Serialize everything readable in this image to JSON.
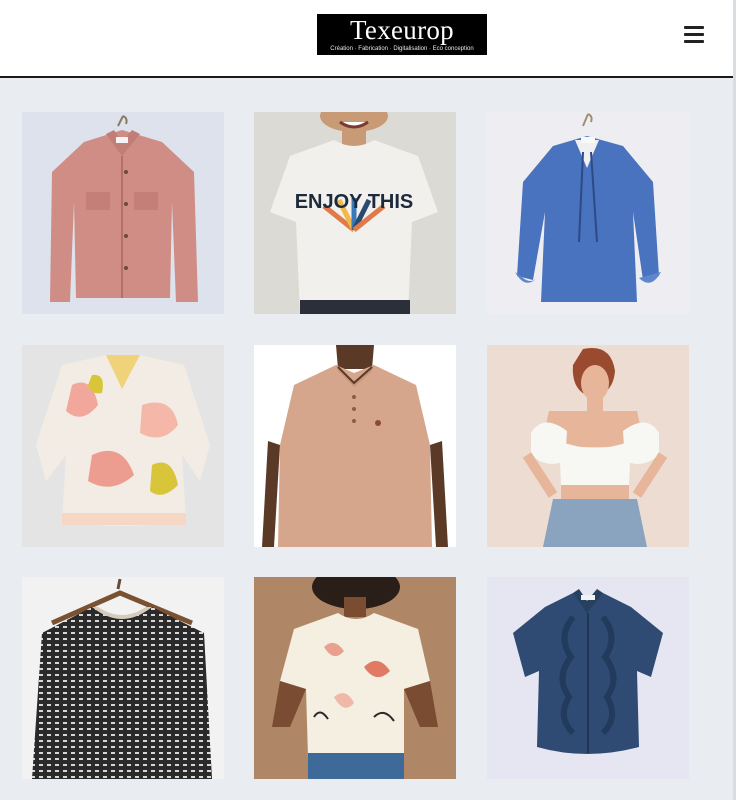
{
  "header": {
    "logo_name": "Texeurop",
    "logo_tagline": "Création · Fabrication · Digitalisation · Eco conception",
    "menu_icon": "hamburger-menu-icon"
  },
  "products": [
    {
      "name": "pink-corduroy-jacket",
      "graphic_text": ""
    },
    {
      "name": "white-tshirt-enjoy-this",
      "graphic_text": "ENJOY THIS"
    },
    {
      "name": "blue-tie-neck-blouse",
      "graphic_text": ""
    },
    {
      "name": "pastel-jacquard-sweater",
      "graphic_text": ""
    },
    {
      "name": "beige-polo-shirt",
      "graphic_text": ""
    },
    {
      "name": "white-puff-sleeve-crop-top",
      "graphic_text": ""
    },
    {
      "name": "black-white-knit-sweater",
      "graphic_text": ""
    },
    {
      "name": "printed-floral-tshirt",
      "graphic_text": ""
    },
    {
      "name": "navy-ruffle-blouse",
      "graphic_text": ""
    }
  ],
  "colors": {
    "page_background": "#e9edf1",
    "header_background": "#ffffff",
    "logo_background": "#000000"
  }
}
